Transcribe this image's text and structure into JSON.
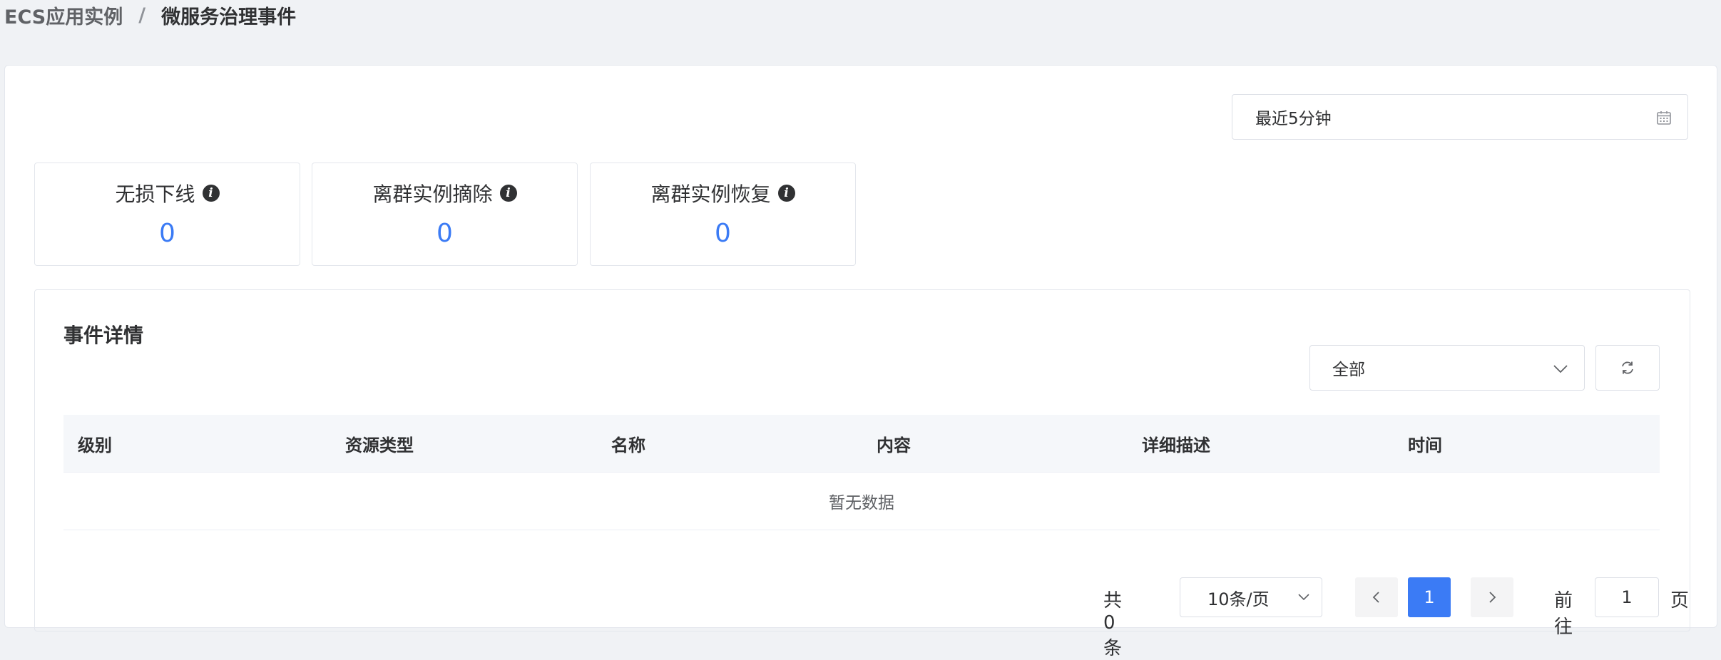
{
  "breadcrumb": {
    "parent": "ECS应用实例",
    "separator": "/",
    "current": "微服务治理事件"
  },
  "time_range": {
    "value": "最近5分钟",
    "icon": "calendar-icon"
  },
  "stats": [
    {
      "title": "无损下线",
      "value": "0"
    },
    {
      "title": "离群实例摘除",
      "value": "0"
    },
    {
      "title": "离群实例恢复",
      "value": "0"
    }
  ],
  "events": {
    "title": "事件详情",
    "filter": {
      "selected": "全部"
    },
    "refresh_icon": "refresh-icon",
    "columns": [
      "级别",
      "资源类型",
      "名称",
      "内容",
      "详细描述",
      "时间"
    ],
    "empty_text": "暂无数据"
  },
  "pagination": {
    "total_text": "共 0 条",
    "page_size": "10条/页",
    "current_page": "1",
    "goto_label": "前往",
    "goto_value": "1",
    "page_unit": "页"
  },
  "colors": {
    "accent": "#3b7bf5",
    "background": "#f0f2f5"
  }
}
